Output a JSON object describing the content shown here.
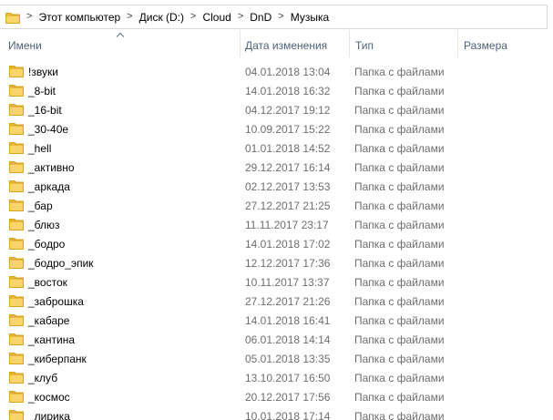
{
  "breadcrumb": {
    "icon": "folder-icon",
    "separator": ">",
    "items": [
      "Этот компьютер",
      "Диск (D:)",
      "Cloud",
      "DnD",
      "Музыка"
    ]
  },
  "columns": {
    "name": "Имени",
    "date": "Дата изменения",
    "type": "Тип",
    "size": "Размера",
    "sorted_by": "name",
    "sort_direction": "ascending"
  },
  "colors": {
    "folder": "#f5c542",
    "header_text": "#4c607a",
    "secondary_text": "#6d6d6d"
  },
  "files": [
    {
      "name": "!звуки",
      "date": "04.01.2018 13:04",
      "type": "Папка с файлами"
    },
    {
      "name": "_8-bit",
      "date": "14.01.2018 16:32",
      "type": "Папка с файлами"
    },
    {
      "name": "_16-bit",
      "date": "04.12.2017 19:12",
      "type": "Папка с файлами"
    },
    {
      "name": "_30-40е",
      "date": "10.09.2017 15:22",
      "type": "Папка с файлами"
    },
    {
      "name": "_hell",
      "date": "01.01.2018 14:52",
      "type": "Папка с файлами"
    },
    {
      "name": "_активно",
      "date": "29.12.2017 16:14",
      "type": "Папка с файлами"
    },
    {
      "name": "_аркада",
      "date": "02.12.2017 13:53",
      "type": "Папка с файлами"
    },
    {
      "name": "_бар",
      "date": "27.12.2017 21:25",
      "type": "Папка с файлами"
    },
    {
      "name": "_блюз",
      "date": "11.11.2017 23:17",
      "type": "Папка с файлами"
    },
    {
      "name": "_бодро",
      "date": "14.01.2018 17:02",
      "type": "Папка с файлами"
    },
    {
      "name": "_бодро_эпик",
      "date": "12.12.2017 17:36",
      "type": "Папка с файлами"
    },
    {
      "name": "_восток",
      "date": "10.11.2017 13:37",
      "type": "Папка с файлами"
    },
    {
      "name": "_заброшка",
      "date": "27.12.2017 21:26",
      "type": "Папка с файлами"
    },
    {
      "name": "_кабаре",
      "date": "14.01.2018 16:41",
      "type": "Папка с файлами"
    },
    {
      "name": "_кантина",
      "date": "06.01.2018 14:14",
      "type": "Папка с файлами"
    },
    {
      "name": "_киберпанк",
      "date": "05.01.2018 13:35",
      "type": "Папка с файлами"
    },
    {
      "name": "_клуб",
      "date": "13.10.2017 16:50",
      "type": "Папка с файлами"
    },
    {
      "name": "_космос",
      "date": "20.12.2017 17:56",
      "type": "Папка с файлами"
    },
    {
      "name": "_лирика",
      "date": "10.01.2018 17:14",
      "type": "Папка с файлами"
    }
  ]
}
